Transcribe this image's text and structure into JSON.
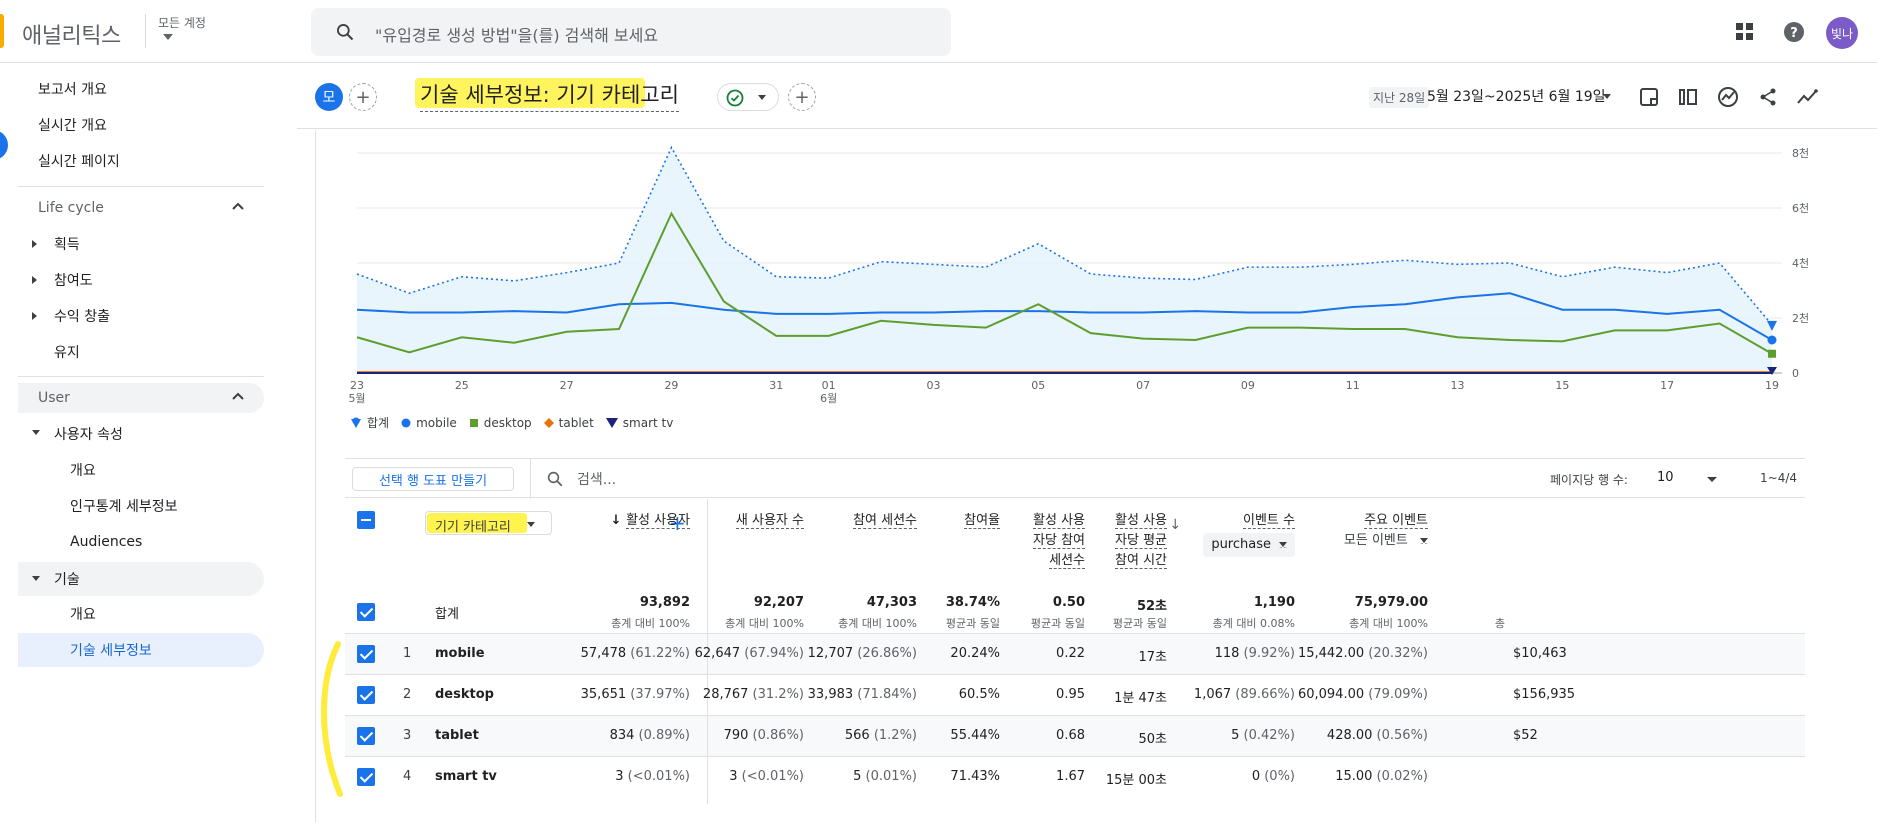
{
  "app": {
    "title": "애널리틱스",
    "account_label": "모든 계정",
    "avatar": "빛나"
  },
  "search": {
    "placeholder": "\"유입경로 생성 방법\"을(를) 검색해 보세요"
  },
  "sidebar": {
    "top_items": [
      "보고서 개요",
      "실시간 개요",
      "실시간 페이지"
    ],
    "lifecycle": {
      "label": "Life cycle",
      "groups": [
        "획득",
        "참여도",
        "수익 창출"
      ],
      "retention": "유지"
    },
    "user": {
      "label": "User",
      "attributes": "사용자 속성",
      "attr_items": [
        "개요",
        "인구통계 세부정보",
        "Audiences"
      ],
      "tech": "기술",
      "tech_items": [
        "개요",
        "기술 세부정보"
      ]
    }
  },
  "header": {
    "chip": "모",
    "title": "기술 세부정보: 기기 카테고리",
    "date_prefix": "지난 28일",
    "date_range": "5월 23일~2025년 6월 19일"
  },
  "chart_data": {
    "type": "line",
    "x": [
      "23",
      "24",
      "25",
      "26",
      "27",
      "28",
      "29",
      "30",
      "31",
      "01",
      "02",
      "03",
      "04",
      "05",
      "06",
      "07",
      "08",
      "09",
      "10",
      "11",
      "12",
      "13",
      "14",
      "15",
      "16",
      "17",
      "18",
      "19"
    ],
    "x_tick_labels": [
      "23",
      "25",
      "27",
      "29",
      "31",
      "01",
      "03",
      "05",
      "07",
      "09",
      "11",
      "13",
      "15",
      "17",
      "19"
    ],
    "x_month_labels": {
      "23": "5월",
      "01": "6월"
    },
    "y_tick_labels": [
      "0",
      "2천",
      "4천",
      "6천",
      "8천"
    ],
    "ylim": [
      0,
      8000
    ],
    "series": [
      {
        "name": "합계",
        "color": "#1a73e8",
        "style": "dotted-area",
        "values": [
          3600,
          2900,
          3500,
          3350,
          3650,
          4000,
          8200,
          4800,
          3500,
          3450,
          4050,
          3950,
          3850,
          4700,
          3600,
          3450,
          3400,
          3850,
          3850,
          3950,
          4100,
          3950,
          4000,
          3500,
          3850,
          3650,
          4000,
          1750
        ]
      },
      {
        "name": "mobile",
        "color": "#1a73e8",
        "values": [
          2300,
          2200,
          2200,
          2250,
          2200,
          2500,
          2550,
          2300,
          2150,
          2150,
          2200,
          2200,
          2250,
          2250,
          2200,
          2200,
          2250,
          2200,
          2200,
          2400,
          2500,
          2750,
          2900,
          2300,
          2300,
          2150,
          2300,
          1200
        ]
      },
      {
        "name": "desktop",
        "color": "#5e9e2e",
        "values": [
          1300,
          750,
          1300,
          1100,
          1500,
          1600,
          5800,
          2600,
          1350,
          1350,
          1900,
          1750,
          1650,
          2500,
          1450,
          1250,
          1200,
          1650,
          1650,
          1600,
          1600,
          1300,
          1200,
          1150,
          1550,
          1550,
          1800,
          700
        ]
      },
      {
        "name": "tablet",
        "color": "#e8710a",
        "values": [
          30,
          30,
          30,
          30,
          30,
          30,
          30,
          30,
          30,
          30,
          30,
          30,
          30,
          30,
          30,
          30,
          30,
          30,
          30,
          30,
          30,
          30,
          30,
          30,
          30,
          30,
          30,
          30
        ]
      },
      {
        "name": "smart tv",
        "color": "#1a237e",
        "values": [
          0,
          0,
          0,
          0,
          0,
          0,
          0,
          0,
          0,
          0,
          0,
          0,
          0,
          0,
          0,
          0,
          0,
          0,
          0,
          0,
          0,
          0,
          0,
          0,
          0,
          0,
          0,
          0
        ]
      }
    ]
  },
  "legend": [
    "합계",
    "mobile",
    "desktop",
    "tablet",
    "smart tv"
  ],
  "toolbar": {
    "plot_button": "선택 행 도표 만들기",
    "search_placeholder": "검색...",
    "rows_label": "페이지당 행 수:",
    "rows_value": "10",
    "pager": "1~4/4"
  },
  "table": {
    "dimension": "기기 카테고리",
    "columns": [
      {
        "lines": [
          "활성 사용자"
        ],
        "sorted": true
      },
      {
        "lines": [
          "새 사용자 수"
        ]
      },
      {
        "lines": [
          "참여 세션수"
        ]
      },
      {
        "lines": [
          "참여율"
        ]
      },
      {
        "lines": [
          "활성 사용",
          "자당 참여",
          "세션수"
        ]
      },
      {
        "lines": [
          "활성 사용",
          "자당 평균",
          "참여 시간"
        ]
      },
      {
        "lines": [
          "이벤트 수"
        ],
        "pill": "purchase"
      },
      {
        "lines": [
          "주요 이벤트"
        ],
        "sub": "모든 이벤트"
      }
    ],
    "total_label": "합계",
    "totals": [
      {
        "v": "93,892",
        "s": "총계 대비 100%"
      },
      {
        "v": "92,207",
        "s": "총계 대비 100%"
      },
      {
        "v": "47,303",
        "s": "총계 대비 100%"
      },
      {
        "v": "38.74%",
        "s": "평균과 동일"
      },
      {
        "v": "0.50",
        "s": "평균과 동일"
      },
      {
        "v": "52초",
        "s": "평균과 동일"
      },
      {
        "v": "1,190",
        "s": "총계 대비 0.08%"
      },
      {
        "v": "75,979.00",
        "s": "총계 대비 100%"
      },
      {
        "v": "",
        "s": "총"
      }
    ],
    "rows": [
      {
        "n": "1",
        "name": "mobile",
        "cells": [
          [
            "57,478",
            "(61.22%)"
          ],
          [
            "62,647",
            "(67.94%)"
          ],
          [
            "12,707",
            "(26.86%)"
          ],
          [
            "20.24%",
            ""
          ],
          [
            "0.22",
            ""
          ],
          [
            "17초",
            ""
          ],
          [
            "118",
            "(9.92%)"
          ],
          [
            "15,442.00",
            "(20.32%)"
          ],
          [
            "$10,463",
            ""
          ]
        ]
      },
      {
        "n": "2",
        "name": "desktop",
        "cells": [
          [
            "35,651",
            "(37.97%)"
          ],
          [
            "28,767",
            "(31.2%)"
          ],
          [
            "33,983",
            "(71.84%)"
          ],
          [
            "60.5%",
            ""
          ],
          [
            "0.95",
            ""
          ],
          [
            "1분 47초",
            ""
          ],
          [
            "1,067",
            "(89.66%)"
          ],
          [
            "60,094.00",
            "(79.09%)"
          ],
          [
            "$156,935",
            ""
          ]
        ]
      },
      {
        "n": "3",
        "name": "tablet",
        "cells": [
          [
            "834",
            "(0.89%)"
          ],
          [
            "790",
            "(0.86%)"
          ],
          [
            "566",
            "(1.2%)"
          ],
          [
            "55.44%",
            ""
          ],
          [
            "0.68",
            ""
          ],
          [
            "50초",
            ""
          ],
          [
            "5",
            "(0.42%)"
          ],
          [
            "428.00",
            "(0.56%)"
          ],
          [
            "$52",
            ""
          ]
        ]
      },
      {
        "n": "4",
        "name": "smart tv",
        "cells": [
          [
            "3",
            "(<0.01%)"
          ],
          [
            "3",
            "(<0.01%)"
          ],
          [
            "5",
            "(0.01%)"
          ],
          [
            "71.43%",
            ""
          ],
          [
            "1.67",
            ""
          ],
          [
            "15분 00초",
            ""
          ],
          [
            "0",
            "(0%)"
          ],
          [
            "15.00",
            "(0.02%)"
          ],
          [
            "",
            ""
          ]
        ]
      }
    ]
  }
}
